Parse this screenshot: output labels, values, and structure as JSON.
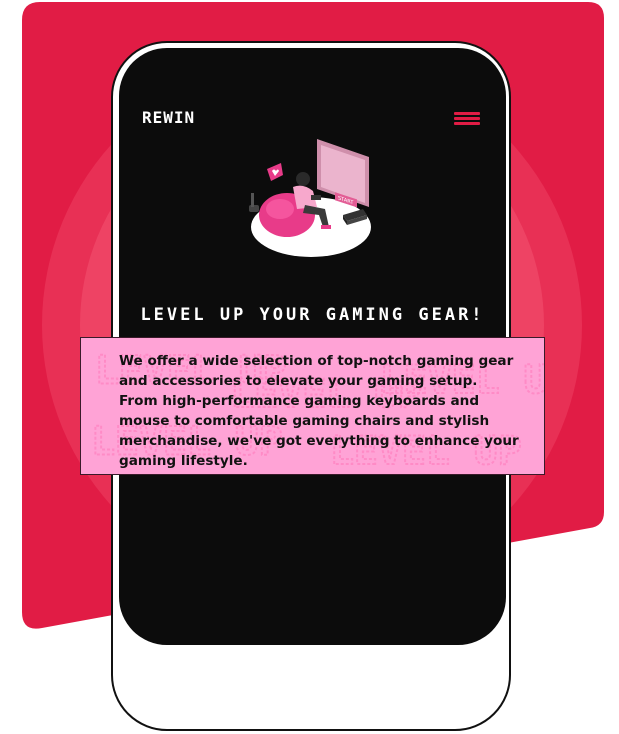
{
  "brand": {
    "logo_text": "REWIN",
    "accent_color": "#e11c45",
    "card_color": "#ffa3d6"
  },
  "nav": {
    "menu_icon": "hamburger-menu-icon"
  },
  "hero": {
    "illustration": "gamer-on-beanbag-illustration",
    "screen_label": "START"
  },
  "main": {
    "headline": "LEVEL UP YOUR GAMING GEAR!",
    "description": "We offer a wide selection of top-notch gaming gear and accessories to elevate your gaming setup. From high-performance gaming keyboards and mouse to comfortable gaming chairs and stylish merchandise, we've got everything to enhance your gaming lifestyle.",
    "card_watermark": "LEVEL UP"
  }
}
